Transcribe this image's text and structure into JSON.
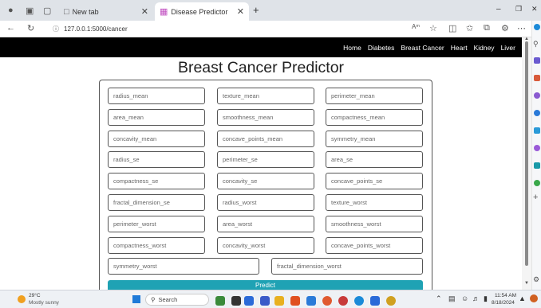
{
  "browser": {
    "tabs": [
      {
        "title": "New tab"
      },
      {
        "title": "Disease Predictor"
      }
    ],
    "new_tab": "+",
    "url": "127.0.0.1:5000/cancer",
    "window_controls": {
      "minimize": "–",
      "close": "✕"
    }
  },
  "site_nav": {
    "items": [
      "Home",
      "Diabetes",
      "Breast Cancer",
      "Heart",
      "Kidney",
      "Liver"
    ]
  },
  "page": {
    "title": "Breast Cancer Predictor",
    "fields": [
      "radius_mean",
      "texture_mean",
      "perimeter_mean",
      "area_mean",
      "smoothness_mean",
      "compactness_mean",
      "concavity_mean",
      "concave_points_mean",
      "symmetry_mean",
      "radius_se",
      "perimeter_se",
      "area_se",
      "compactness_se",
      "concavity_se",
      "concave_points_se",
      "fractal_dimension_se",
      "radius_worst",
      "texture_worst",
      "perimeter_worst",
      "area_worst",
      "smoothness_worst",
      "compactness_worst",
      "concavity_worst",
      "concave_points_worst",
      "symmetry_worst",
      "fractal_dimension_worst"
    ],
    "predict_label": "Predict"
  },
  "taskbar": {
    "weather_temp": "29°C",
    "weather_desc": "Mostly sunny",
    "search_placeholder": "Search",
    "time": "11:54 AM",
    "date": "8/18/2024"
  },
  "colors": {
    "navbar": "#000000",
    "predict_button": "#1fa2b4",
    "tabstrip": "#dfe3e8"
  }
}
